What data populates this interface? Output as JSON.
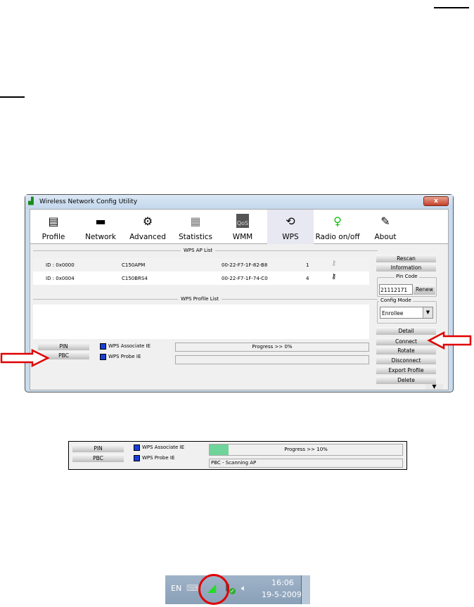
{
  "window": {
    "title": "Wireless Network Config Utility",
    "close_label": "x",
    "tabs": [
      {
        "label": "Profile",
        "icon": "profile-icon"
      },
      {
        "label": "Network",
        "icon": "router-icon"
      },
      {
        "label": "Advanced",
        "icon": "gears-icon"
      },
      {
        "label": "Statistics",
        "icon": "statistics-icon"
      },
      {
        "label": "WMM",
        "icon": "qos-icon"
      },
      {
        "label": "WPS",
        "icon": "wps-icon",
        "active": true
      },
      {
        "label": "Radio on/off",
        "icon": "radio-icon"
      },
      {
        "label": "About",
        "icon": "about-icon"
      }
    ],
    "ap_list": {
      "title": "WPS AP List",
      "rows": [
        {
          "id": "ID : 0x0000",
          "ssid": "C150APM",
          "bssid": "00-22-F7-1F-82-B8",
          "channel": "1"
        },
        {
          "id": "ID : 0x0004",
          "ssid": "C150BRS4",
          "bssid": "00-22-F7-1F-74-C0",
          "channel": "4"
        }
      ]
    },
    "profile_list": {
      "title": "WPS Profile List"
    },
    "pin_button": "PIN",
    "pbc_button": "PBC",
    "wps_associate_ie": "WPS Associate IE",
    "wps_probe_ie": "WPS Probe IE",
    "progress_text": "Progress >> 0%",
    "progress_value": 0,
    "status_text": "",
    "side": {
      "rescan": "Rescan",
      "information": "Information",
      "pin_code_label": "Pin Code",
      "pin_code": "21112171",
      "renew": "Renew",
      "config_mode_label": "Config Mode",
      "config_mode": "Enrollee",
      "detail": "Detail",
      "connect": "Connect",
      "rotate": "Rotate",
      "disconnect": "Disconnect",
      "export_profile": "Export Profile",
      "delete": "Delete"
    }
  },
  "panel2": {
    "pin_button": "PIN",
    "pbc_button": "PBC",
    "wps_associate_ie": "WPS Associate IE",
    "wps_probe_ie": "WPS Probe IE",
    "progress_text": "Progress >> 10%",
    "progress_value": 10,
    "status_text": "PBC - Scanning AP",
    "progress_color": "#6fd49a"
  },
  "taskbar": {
    "language": "EN",
    "time": "16:06",
    "date": "19-5-2009"
  },
  "colors": {
    "highlight": "#e00000"
  }
}
